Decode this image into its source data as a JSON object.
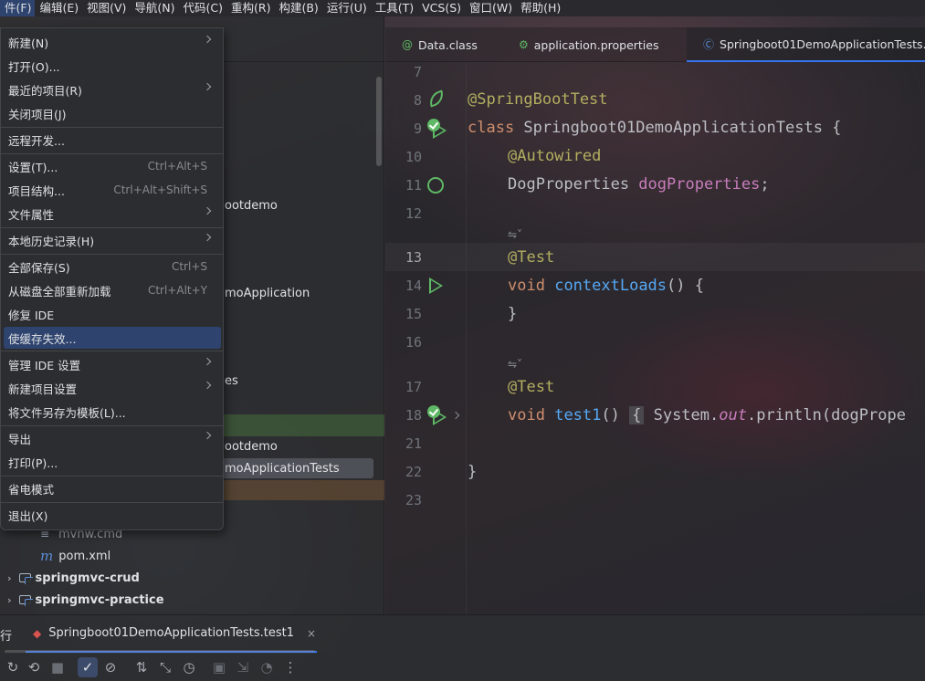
{
  "menubar": {
    "items": [
      "件(F)",
      "编辑(E)",
      "视图(V)",
      "导航(N)",
      "代码(C)",
      "重构(R)",
      "构建(B)",
      "运行(U)",
      "工具(T)",
      "VCS(S)",
      "窗口(W)",
      "帮助(H)"
    ]
  },
  "file_menu": {
    "new": "新建(N)",
    "open": "打开(O)...",
    "recent": "最近的项目(R)",
    "close_project": "关闭项目(J)",
    "remote_dev": "远程开发...",
    "settings": "设置(T)...",
    "settings_sc": "Ctrl+Alt+S",
    "project_structure": "项目结构...",
    "project_structure_sc": "Ctrl+Alt+Shift+S",
    "file_properties": "文件属性",
    "local_history": "本地历史记录(H)",
    "save_all": "全部保存(S)",
    "save_all_sc": "Ctrl+S",
    "reload": "从磁盘全部重新加载",
    "reload_sc": "Ctrl+Alt+Y",
    "repair_ide": "修复 IDE",
    "invalidate_caches": "使缓存失效...",
    "manage_ide_settings": "管理 IDE 设置",
    "new_project_settings": "新建项目设置",
    "save_as_template": "将文件另存为模板(L)...",
    "export": "导出",
    "print": "打印(P)...",
    "power_save": "省电模式",
    "exit": "退出(X)"
  },
  "project_tree": {
    "partial_1": "ootdemo",
    "partial_2": "moApplication",
    "partial_3": "es",
    "partial_4": "ootdemo",
    "partial_5": "moApplicationTests",
    "mvnw_cmd": "mvnw.cmd",
    "pom": "pom.xml",
    "module_1": "springmvc-crud",
    "module_2": "springmvc-practice"
  },
  "tabs": [
    {
      "label": "Data.class",
      "icon": "annotation-class-icon"
    },
    {
      "label": "application.properties",
      "icon": "properties-file-icon"
    },
    {
      "label": "Springboot01DemoApplicationTests.",
      "icon": "java-class-icon"
    }
  ],
  "gutter": {
    "l7": "7",
    "l8": "8",
    "l9": "9",
    "l10": "10",
    "l11": "11",
    "l12": "12",
    "l13": "13",
    "l14": "14",
    "l15": "15",
    "l16": "16",
    "l17": "17",
    "l18": "18",
    "l21": "21",
    "l22": "22",
    "l23": "23"
  },
  "code": {
    "spring_boot_test": "@SpringBootTest",
    "class_kw": "class",
    "class_name": " Springboot01DemoApplicationTests {",
    "autowired": "@Autowired",
    "field_type": "DogProperties ",
    "field_name": "dogProperties",
    "semicolon": ";",
    "test_ann_1": "@Test",
    "void_1": "void",
    "method_1": "contextLoads",
    "method_1_rest": "() {",
    "close_brace_1": "}",
    "test_ann_2": "@Test",
    "void_2": "void",
    "method_2": "test1",
    "method_2_paren": "() ",
    "method_2_brace": "{",
    "system": " System.",
    "out": "out",
    "println": ".println(dogPrope",
    "class_close": "}",
    "inlay_1": "⇋˅",
    "inlay_2": "⇋˅"
  },
  "run_panel": {
    "left_label": "行",
    "tab_label": "Springboot01DemoApplicationTests.test1",
    "close": "×"
  },
  "colors": {
    "accent": "#3574f0",
    "selection": "#2e436e",
    "run_green": "#5fb865"
  }
}
